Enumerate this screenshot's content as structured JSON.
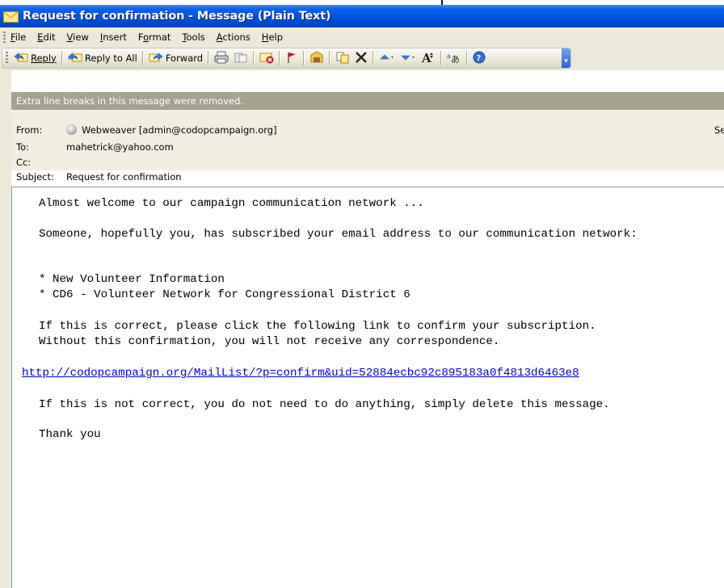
{
  "window": {
    "title": "Request for confirmation - Message (Plain Text)"
  },
  "menu": [
    "File",
    "Edit",
    "View",
    "Insert",
    "Format",
    "Tools",
    "Actions",
    "Help"
  ],
  "menu_accel": [
    "F",
    "E",
    "V",
    "I",
    "o",
    "T",
    "A",
    "H"
  ],
  "toolbar": {
    "reply": "Reply",
    "reply_all": "Reply to All",
    "forward": "Forward"
  },
  "infobar": {
    "text": "Extra line breaks in this message were removed."
  },
  "header": {
    "from_label": "From:",
    "from_value": "Webweaver [admin@codopcampaign.org]",
    "to_label": "To:",
    "to_value": "mahetrick@yahoo.com",
    "cc_label": "Cc:",
    "cc_value": "",
    "subject_label": "Subject:",
    "subject_value": "Request for confirmation",
    "sent_truncated": "Se"
  },
  "body": {
    "line1": "Almost welcome to our campaign communication network ...",
    "line2": "Someone, hopefully you, has subscribed your email address to our communication network:",
    "list1": "* New Volunteer Information",
    "list2": "* CD6 - Volunteer Network for Congressional District 6",
    "line3": "If this is correct, please click the following link to confirm your subscription.",
    "line4": "Without this confirmation, you will not receive any correspondence.",
    "link": "http://codopcampaign.org/MailList/?p=confirm&uid=52884ecbc92c895183a0f4813d6463e8",
    "line5": "If this is not correct, you do not need to do anything, simply delete this message.",
    "line6": "Thank you"
  },
  "colors": {
    "titlebar": "#0054e3",
    "chrome": "#ece9d8",
    "infobar": "#a4a290",
    "header_bg": "#f1efe2",
    "link": "#0000ee"
  }
}
